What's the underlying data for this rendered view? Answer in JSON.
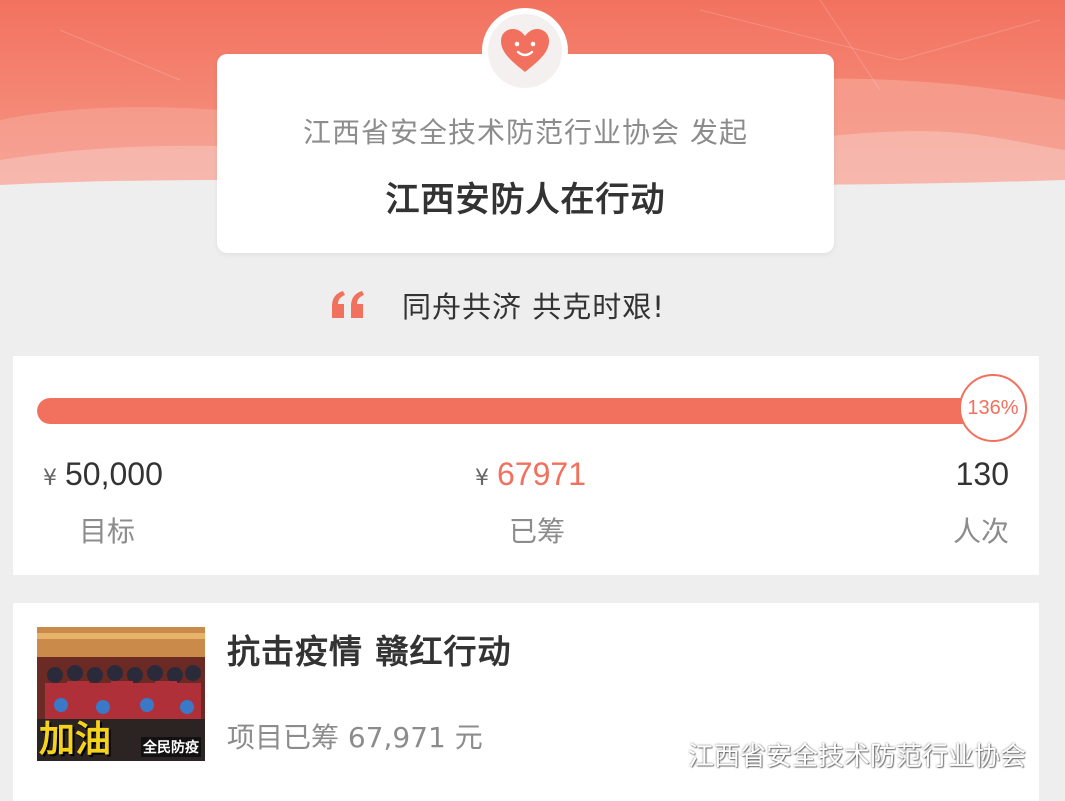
{
  "header": {
    "organizer": "江西省安全技术防范行业协会 发起",
    "title": "江西安防人在行动"
  },
  "slogan": "同舟共济 共克时艰!",
  "progress": {
    "percent_label": "136%",
    "fill_fraction": 1.0
  },
  "stats": {
    "goal": {
      "currency": "¥",
      "value": "50,000",
      "label": "目标"
    },
    "raised": {
      "currency": "¥",
      "value": "67971",
      "label": "已筹"
    },
    "count": {
      "value": "130",
      "label": "人次"
    }
  },
  "project": {
    "title": "抗击疫情 赣红行动",
    "raised_text": "项目已筹 67,971 元",
    "thumb_banner": "加油",
    "thumb_tag": "全民防疫"
  },
  "watermark": "江西省安全技术防范行业协会",
  "colors": {
    "accent": "#f2705e",
    "hero": "#f2725f",
    "background": "#efeeee"
  },
  "icons": {
    "badge": "heart-icon",
    "quote": "quote-icon",
    "watermark": "wechat-icon"
  }
}
